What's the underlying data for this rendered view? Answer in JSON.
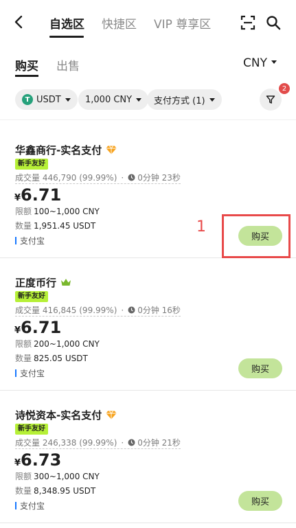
{
  "header": {
    "tabs": [
      {
        "label": "自选区",
        "active": true
      },
      {
        "label": "快捷区",
        "active": false
      },
      {
        "label": "VIP 尊享区",
        "active": false
      }
    ]
  },
  "sub_tabs": [
    {
      "label": "购买",
      "active": true
    },
    {
      "label": "出售",
      "active": false
    }
  ],
  "currency": "CNY",
  "filters": {
    "coin": "USDT",
    "coin_icon": "T",
    "amount": "1,000 CNY",
    "payment": "支付方式 (1)",
    "badge_count": "2"
  },
  "offers": [
    {
      "merchant": "华鑫商行-实名支付",
      "badge_icon": "diamond-icon",
      "tag": "新手友好",
      "volume": "成交量 446,790 (99.99%)",
      "time": "0分钟 23秒",
      "currency_symbol": "¥",
      "price": "6.71",
      "limit_label": "限额",
      "limit": "100~1,000 CNY",
      "qty_label": "数量",
      "quantity": "1,951.45 USDT",
      "payment": "支付宝",
      "buy_label": "购买"
    },
    {
      "merchant": "正度币行",
      "badge_icon": "crown-icon",
      "tag": "新手友好",
      "volume": "成交量 416,845 (99.99%)",
      "time": "0分钟 16秒",
      "currency_symbol": "¥",
      "price": "6.71",
      "limit_label": "限额",
      "limit": "200~1,000 CNY",
      "qty_label": "数量",
      "quantity": "825.05 USDT",
      "payment": "支付宝",
      "buy_label": "购买"
    },
    {
      "merchant": "诗悦资本-实名支付",
      "badge_icon": "diamond-icon",
      "tag": "新手友好",
      "volume": "成交量 246,338 (99.99%)",
      "time": "0分钟 21秒",
      "currency_symbol": "¥",
      "price": "6.73",
      "limit_label": "限额",
      "limit": "300~1,000 CNY",
      "qty_label": "数量",
      "quantity": "8,348.95 USDT",
      "payment": "支付宝",
      "buy_label": "购买"
    }
  ],
  "annotation": {
    "label": "1",
    "color": "#e84a4a"
  }
}
